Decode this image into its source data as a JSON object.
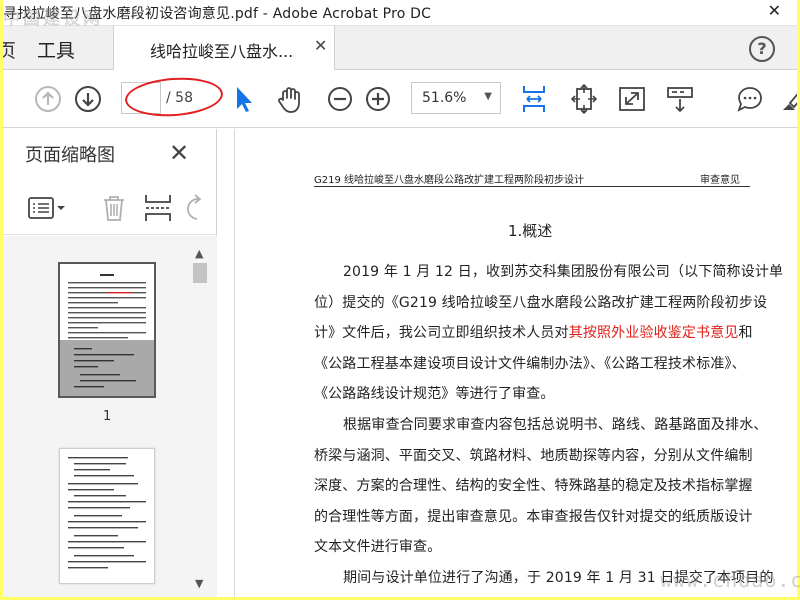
{
  "window": {
    "title": "寻找拉峻至八盘水磨段初设咨询意见.pdf - Adobe Acrobat Pro DC",
    "close_glyph": "✕"
  },
  "watermarks": {
    "top_left": "中国建设网",
    "bottom_right": "www.chdao.com"
  },
  "tabs": {
    "cut_label": "页",
    "tools_label": "工具",
    "doc_label": "线哈拉峻至八盘水...",
    "close_glyph": "✕",
    "help_glyph": "?"
  },
  "toolbar": {
    "current_page": "",
    "page_total": "/ 58",
    "zoom": "51.6%",
    "zoom_dropdown_glyph": "▼",
    "icons": [
      "prev-page-icon",
      "next-page-icon",
      "select-arrow-icon",
      "hand-icon",
      "zoom-out-icon",
      "zoom-in-icon",
      "fit-width-icon",
      "fit-page-icon",
      "fullscreen-icon",
      "scrolling-mode-icon",
      "comment-icon",
      "highlight-pen-icon"
    ]
  },
  "annotation": {
    "color": "#e02020"
  },
  "left_panel": {
    "title": "页面缩略图",
    "close_glyph": "✕",
    "tool_icons": [
      "thumbnail-options-icon",
      "delete-page-icon",
      "insert-page-icon",
      "rotate-page-icon"
    ],
    "thumbnails": [
      {
        "page_label": "1",
        "selected": true
      },
      {
        "page_label": "",
        "selected": false
      }
    ],
    "scroll_up_glyph": "▲",
    "scroll_down_glyph": "▼",
    "collapse_glyph": "◀"
  },
  "document": {
    "header_left": "G219 线哈拉峻至八盘水磨段公路改扩建工程两阶段初步设计",
    "header_right": "审查意见",
    "heading": "1.概述",
    "lines": [
      {
        "indent": true,
        "segments": [
          {
            "text": "2019 年 1 月 12 日，收到苏交科集团股份有限公司（以下简称设计单"
          }
        ]
      },
      {
        "indent": false,
        "segments": [
          {
            "text": "位）提交的《G219 线哈拉峻至八盘水磨段公路改扩建工程两阶段初步设"
          }
        ]
      },
      {
        "indent": false,
        "segments": [
          {
            "text": "计》文件后，我公司立即组织技术人员对"
          },
          {
            "text": "其按照外业验收鉴定书意见",
            "red": true
          },
          {
            "text": "和"
          }
        ]
      },
      {
        "indent": false,
        "segments": [
          {
            "text": "《公路工程基本建设项目设计文件编制办法》、《公路工程技术标准》、"
          }
        ]
      },
      {
        "indent": false,
        "segments": [
          {
            "text": "《公路路线设计规范》等进行了审查。"
          }
        ]
      },
      {
        "indent": true,
        "segments": [
          {
            "text": "根据审查合同要求审查内容包括总说明书、路线、路基路面及排水、"
          }
        ]
      },
      {
        "indent": false,
        "segments": [
          {
            "text": "桥梁与涵洞、平面交叉、筑路材料、地质勘探等内容，分别从文件编制"
          }
        ]
      },
      {
        "indent": false,
        "segments": [
          {
            "text": "深度、方案的合理性、结构的安全性、特殊路基的稳定及技术指标掌握"
          }
        ]
      },
      {
        "indent": false,
        "segments": [
          {
            "text": "的合理性等方面，提出审查意见。本审查报告仅针对提交的纸质版设计"
          }
        ]
      },
      {
        "indent": false,
        "segments": [
          {
            "text": "文本文件进行审查。"
          }
        ]
      },
      {
        "indent": true,
        "segments": [
          {
            "text": "期间与设计单位进行了沟通，于 2019 年 1 月 31 日提交了本项目的"
          }
        ]
      }
    ]
  }
}
